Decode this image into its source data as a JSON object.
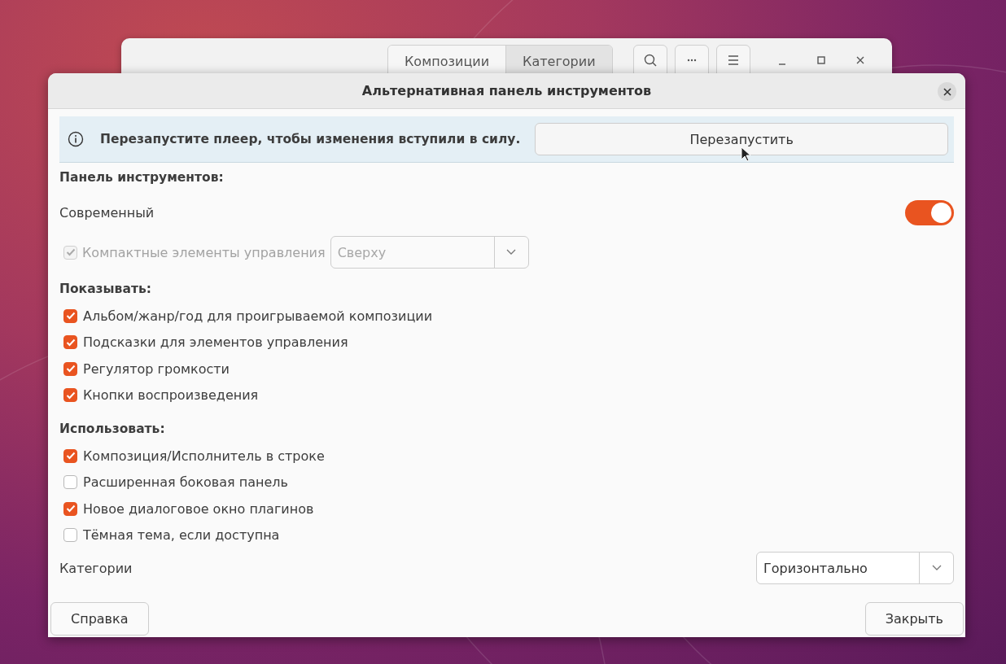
{
  "background_window": {
    "tabs": [
      {
        "label": "Композиции",
        "selected": false
      },
      {
        "label": "Категории",
        "selected": true
      }
    ]
  },
  "dialog": {
    "title": "Альтернативная панель инструментов"
  },
  "info_bar": {
    "message": "Перезапустите плеер, чтобы изменения вступили в силу.",
    "button": "Перезапустить"
  },
  "sections": [
    {
      "heading": "Панель инструментов:",
      "items": [
        {
          "kind": "toggle",
          "label": "Современный",
          "on": true
        },
        {
          "kind": "checkbox_combo",
          "label": "Компактные элементы управления",
          "checked": true,
          "disabled": true,
          "value": "Сверху"
        }
      ]
    },
    {
      "heading": "Показывать:",
      "items": [
        {
          "kind": "checkbox",
          "label": "Альбом/жанр/год для проигрываемой композиции",
          "checked": true
        },
        {
          "kind": "checkbox",
          "label": "Подсказки для элементов управления",
          "checked": true
        },
        {
          "kind": "checkbox",
          "label": "Регулятор громкости",
          "checked": true
        },
        {
          "kind": "checkbox",
          "label": "Кнопки воспроизведения",
          "checked": true
        }
      ]
    },
    {
      "heading": "Использовать:",
      "items": [
        {
          "kind": "checkbox",
          "label": "Композиция/Исполнитель в строке",
          "checked": true
        },
        {
          "kind": "checkbox",
          "label": "Расширенная боковая панель",
          "checked": false
        },
        {
          "kind": "checkbox",
          "label": "Новое диалоговое окно плагинов",
          "checked": true
        },
        {
          "kind": "checkbox",
          "label": "Тёмная тема, если доступна",
          "checked": false
        },
        {
          "kind": "combo",
          "label": "Категории",
          "value": "Горизонтально"
        }
      ]
    }
  ],
  "buttons": [
    {
      "label": "Справка"
    },
    {
      "label": "Закрыть"
    }
  ]
}
